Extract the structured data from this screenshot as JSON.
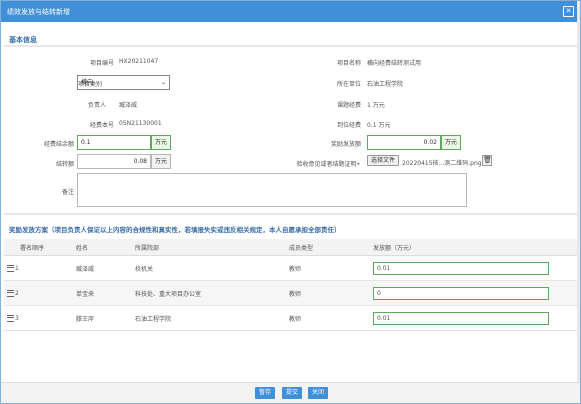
{
  "window": {
    "title": "绩效发放与结转新增"
  },
  "basic": {
    "section_title": "基本信息",
    "project_no_label": "项目编号",
    "project_no": "HX20211047",
    "project_name_label": "项目名称",
    "project_name": "横向经费结转测试用",
    "project_type_label": "项目类别",
    "project_type": "横向",
    "unit_label": "所在单位",
    "unit": "石油工程学院",
    "leader_label": "负责人",
    "leader": "臧泽威",
    "topic_fund_label": "课题经费",
    "topic_fund": "1 万元",
    "fund_book_label": "经费本号",
    "fund_book": "05N21130001",
    "arrived_fund_label": "到位经费",
    "arrived_fund": "0.1 万元",
    "balance_label": "经费结余额",
    "balance": "0.1",
    "reward_label": "奖励发放额",
    "reward": "0.02",
    "carry_label": "结转额",
    "carry": "0.08",
    "unit_wanyuan": "万元",
    "acceptance_label": "验收意见或者结题证明",
    "choose_file": "选择文件",
    "file_name": "20220415核...测二维码.png",
    "remark_label": "备注",
    "remark": ""
  },
  "plan": {
    "section_title": "奖励发放方案（项目负责人保证以上内容的合规性和真实性，若填报失实或违反相关规定，本人自愿承担全部责任）",
    "columns": [
      "署名顺序",
      "姓名",
      "所属院部",
      "成员类型",
      "发放额（万元）"
    ],
    "rows": [
      {
        "order": "1",
        "name": "臧泽威",
        "dept": "校机关",
        "type": "教师",
        "amount": "0.01"
      },
      {
        "order": "2",
        "name": "单宝来",
        "dept": "科技处、重大项目办公室",
        "type": "教师",
        "amount": "0"
      },
      {
        "order": "3",
        "name": "滕王岸",
        "dept": "石油工程学院",
        "type": "教师",
        "amount": "0.01"
      }
    ]
  },
  "footer": {
    "save": "暂存",
    "submit": "提交",
    "close": "关闭"
  }
}
